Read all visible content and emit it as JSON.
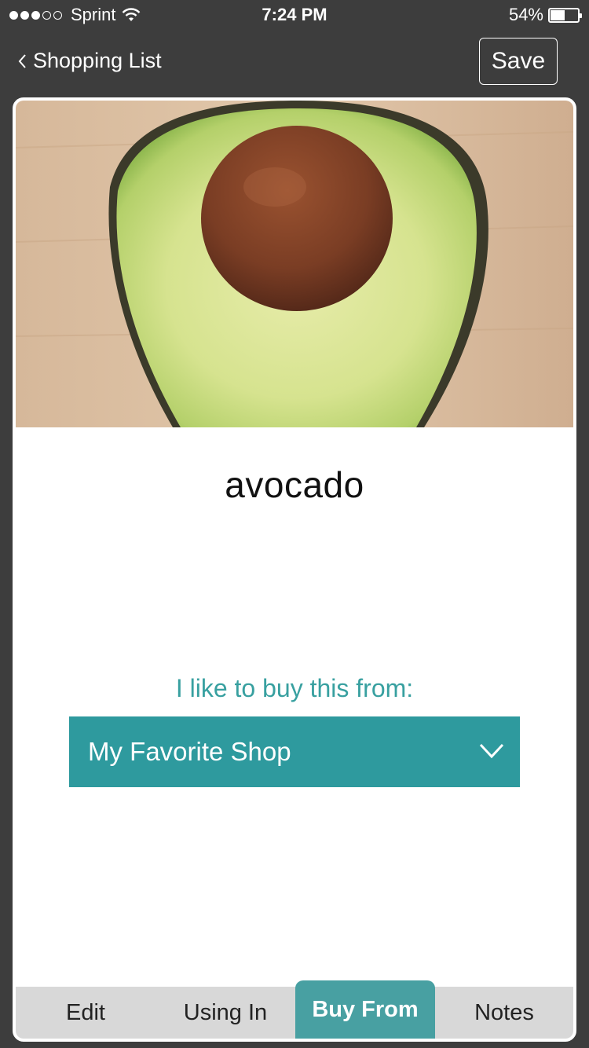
{
  "status_bar": {
    "carrier": "Sprint",
    "time": "7:24 PM",
    "battery_percent": "54%",
    "signal_bars_filled": 3,
    "signal_bars_total": 5,
    "battery_level": 0.54
  },
  "nav": {
    "back_label": "Shopping List",
    "back_icon": "chevron-left-icon",
    "save_label": "Save"
  },
  "item": {
    "name": "avocado",
    "photo": "avocado-half-photo"
  },
  "buy_from": {
    "label": "I like to buy this from:",
    "selected_shop": "My Favorite Shop",
    "dropdown_icon": "chevron-down-icon"
  },
  "tabs": [
    {
      "label": "Edit",
      "active": false
    },
    {
      "label": "Using In",
      "active": false
    },
    {
      "label": "Buy From",
      "active": true
    },
    {
      "label": "Notes",
      "active": false
    }
  ],
  "colors": {
    "background": "#3d3d3d",
    "accent": "#2e9a9e",
    "active_tab": "#48a0a2",
    "tab_bar": "#d8d8d8"
  }
}
